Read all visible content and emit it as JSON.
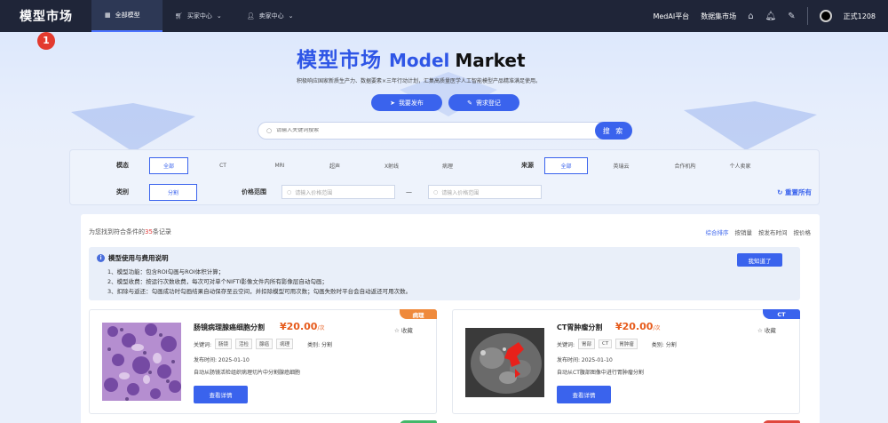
{
  "nav": {
    "logo": "模型市场",
    "tabs": [
      "全部模型",
      "买家中心",
      "卖家中心"
    ],
    "right_links": [
      "MedAI平台",
      "数据集市场"
    ],
    "user": "正式1208"
  },
  "annotation_badge": "1",
  "hero": {
    "title_cn": "模型市场",
    "title_en1": "Model",
    "title_en2": "Market",
    "subtitle": "积极响应国家新质生产力、数据要素×三年行动计划，汇集高质量医学人工智能模型产品精准满足使用。",
    "btn_publish": "我要发布",
    "btn_demand": "需求登记",
    "search_placeholder": "请输入关键词搜索",
    "search_btn": "搜 索"
  },
  "filters": {
    "modality_label": "模态",
    "modality_options": [
      "全部",
      "CT",
      "MRI",
      "超声",
      "X射线",
      "病理"
    ],
    "source_label": "来源",
    "source_options": [
      "全部",
      "英瑞云",
      "合作机构",
      "个人卖家"
    ],
    "category_label": "类别",
    "category_selected": "分割",
    "price_label": "价格范围",
    "price_placeholder": "请输入价格范围",
    "price_sep": "—",
    "reset": "重置所有"
  },
  "results": {
    "count_prefix": "为您找到符合条件的",
    "count": "35",
    "count_suffix": "条记录",
    "sorts": [
      "综合排序",
      "按销量",
      "按发布时间",
      "按价格"
    ]
  },
  "notice": {
    "title": "模型使用与费用说明",
    "lines": [
      "1、模型功能：包含ROI勾画与ROI体积计算；",
      "2、模型收费：按运行次数收费，每次可对单个NIFTI影像文件内所有影像层自动勾画；",
      "3、扣除与返还：勾画成功时勾画结果自动保存至云空间，并扣除模型可用次数；勾画失败时平台会自动返还可用次数。"
    ],
    "ok_btn": "我知道了"
  },
  "cards": [
    {
      "title": "肠镜病理腺癌细胞分割",
      "price": "¥20.00",
      "unit": "/次",
      "fav": "收藏",
      "kw_label": "关键词:",
      "tags": [
        "肠镜",
        "活检",
        "腺癌",
        "病理"
      ],
      "cat": "类别: 分割",
      "date": "发布时间: 2025-01-10",
      "desc": "自动从肠镜活检组织病理切片中分割腺癌细胞",
      "btn": "查看详情",
      "type": "病理",
      "type_color": "#ef8a3c"
    },
    {
      "title": "CT胃肿瘤分割",
      "price": "¥20.00",
      "unit": "/次",
      "fav": "收藏",
      "kw_label": "关键词:",
      "tags": [
        "胃部",
        "CT",
        "胃肿瘤"
      ],
      "cat": "类别: 分割",
      "date": "发布时间: 2025-01-10",
      "desc": "自动从CT腹部图像中进行胃肿瘤分割",
      "btn": "查看详情",
      "type": "CT",
      "type_color": "#3a63ed"
    }
  ],
  "colors": {
    "accent": "#3a63ed",
    "nav_bg": "#1f2538",
    "price": "#e65b1c"
  }
}
